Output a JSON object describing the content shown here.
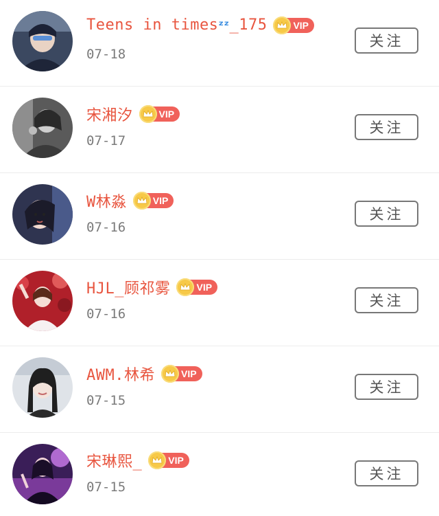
{
  "followers": [
    {
      "name_prefix": "Teens in times",
      "name_emoji": "💤",
      "name_suffix": "_175",
      "vip_label": "VIP",
      "date": "07-18",
      "follow_label": "关注",
      "avatar_colors": [
        "#2b3a5a",
        "#e3e8ee",
        "#4a6fa8"
      ]
    },
    {
      "name": "宋湘汐",
      "vip_label": "VIP",
      "date": "07-17",
      "follow_label": "关注",
      "avatar_colors": [
        "#3c3c3c",
        "#9a9a9a",
        "#6a6a6a"
      ]
    },
    {
      "name": "W林淼",
      "vip_label": "VIP",
      "date": "07-16",
      "follow_label": "关注",
      "avatar_colors": [
        "#2a2e4a",
        "#f0d6cc",
        "#3d3d5e"
      ]
    },
    {
      "name": "HJL_顾祁雾",
      "vip_label": "VIP",
      "date": "07-16",
      "follow_label": "关注",
      "avatar_colors": [
        "#c0232c",
        "#f3e6ea",
        "#7a1a20"
      ]
    },
    {
      "name": "AWM.林希",
      "vip_label": "VIP",
      "date": "07-15",
      "follow_label": "关注",
      "avatar_colors": [
        "#d6d9de",
        "#2a2a2a",
        "#f2e4dc"
      ]
    },
    {
      "name": "宋琳熙_",
      "vip_label": "VIP",
      "date": "07-15",
      "follow_label": "关注",
      "avatar_colors": [
        "#4a2a6a",
        "#c79ad8",
        "#2a1840"
      ]
    }
  ],
  "colors": {
    "name": "#e8553f",
    "vip_badge": "#f0615a",
    "crown": "#f7c948",
    "date": "#7b7b7b",
    "button_border": "#777777"
  },
  "icons": {
    "crown": "crown-icon",
    "sleep": "sleeping-zzz-icon"
  }
}
